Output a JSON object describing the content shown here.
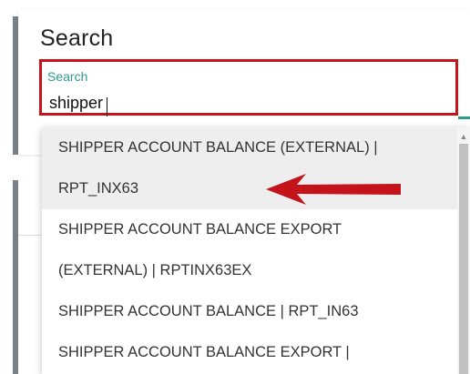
{
  "search_card": {
    "title": "Search",
    "field_label": "Search",
    "value": "shipper"
  },
  "dropdown": {
    "options": [
      {
        "line1": "SHIPPER ACCOUNT BALANCE (EXTERNAL) |",
        "line2": "RPT_INX63",
        "highlighted": true
      },
      {
        "line1": "SHIPPER ACCOUNT BALANCE EXPORT",
        "line2": "(EXTERNAL) | RPTINX63EX",
        "highlighted": false
      },
      {
        "line1": "SHIPPER ACCOUNT BALANCE | RPT_IN63",
        "line2": "",
        "highlighted": false
      },
      {
        "line1": "SHIPPER ACCOUNT BALANCE EXPORT |",
        "line2": "",
        "highlighted": false
      }
    ]
  },
  "colors": {
    "highlight_border": "#c4131a",
    "accent": "#2e9b8b",
    "arrow": "#c4131a"
  },
  "icons": {
    "scroll_up": "chevron-up-icon",
    "annotation": "red-arrow-icon"
  }
}
